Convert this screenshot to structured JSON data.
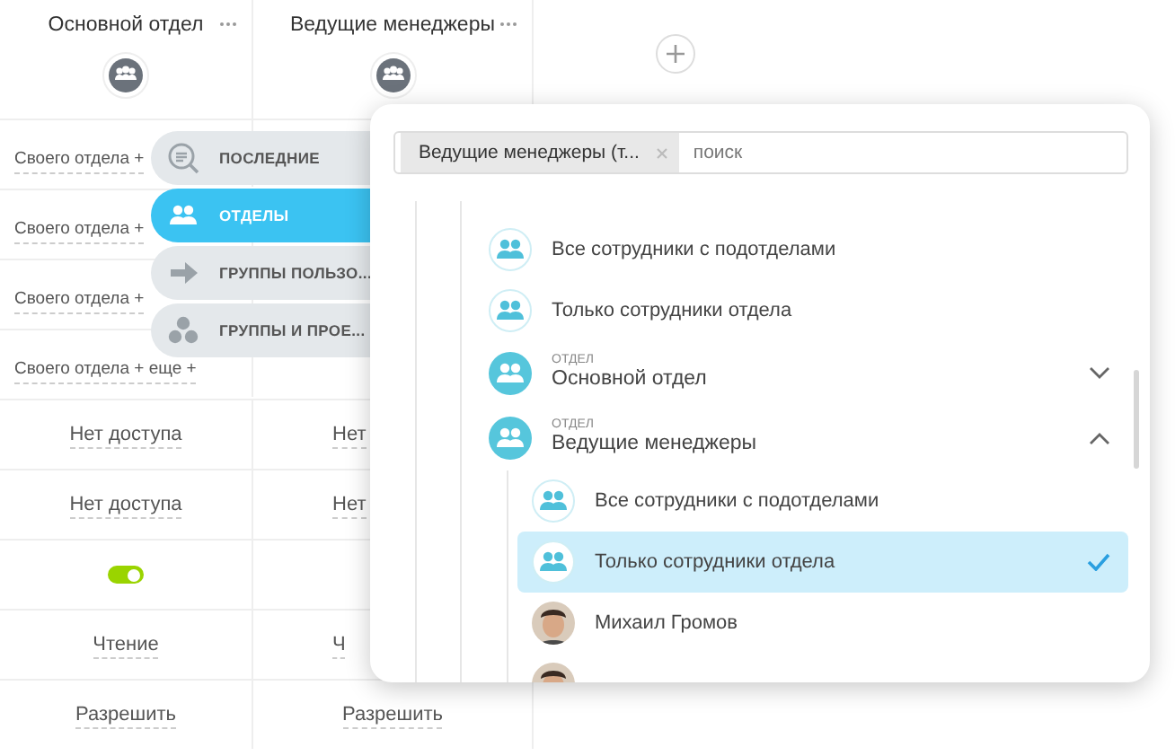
{
  "table": {
    "columns": [
      {
        "title": "Основной отдел"
      },
      {
        "title": "Ведущие менеджеры"
      }
    ],
    "rows": [
      {
        "cells": [
          {
            "kind": "link",
            "text": "Своего отдела +"
          }
        ]
      },
      {
        "cells": [
          {
            "kind": "link",
            "text": "Своего отдела +"
          }
        ]
      },
      {
        "cells": [
          {
            "kind": "link",
            "text": "Своего отдела +"
          }
        ]
      },
      {
        "cells": [
          {
            "kind": "link",
            "text": "Своего отдела + еще +"
          }
        ]
      },
      {
        "cells": [
          {
            "kind": "value",
            "text": "Нет доступа"
          },
          {
            "kind": "cut",
            "text": "Нет"
          }
        ]
      },
      {
        "cells": [
          {
            "kind": "value",
            "text": "Нет доступа"
          },
          {
            "kind": "cut",
            "text": "Нет"
          }
        ]
      },
      {
        "cells": [
          {
            "kind": "toggle",
            "on": true
          }
        ]
      },
      {
        "cells": [
          {
            "kind": "value",
            "text": "Чтение"
          },
          {
            "kind": "cut",
            "text": "Ч"
          }
        ]
      },
      {
        "cells": [
          {
            "kind": "value",
            "text": "Разрешить"
          },
          {
            "kind": "value",
            "text": "Разрешить"
          }
        ]
      }
    ]
  },
  "side_menu": [
    {
      "label": "ПОСЛЕДНИЕ",
      "selected": false
    },
    {
      "label": "ОТДЕЛЫ",
      "selected": true
    },
    {
      "label": "ГРУППЫ ПОЛЬЗО...",
      "selected": false
    },
    {
      "label": "ГРУППЫ И ПРОЕ...",
      "selected": false
    }
  ],
  "popup": {
    "search": {
      "chip": "Ведущие менеджеры (т...",
      "placeholder": "поиск"
    },
    "tree": [
      {
        "kind": "option",
        "label": "Все сотрудники с подотделами",
        "selected": false
      },
      {
        "kind": "option",
        "label": "Только сотрудники отдела",
        "selected": false
      },
      {
        "kind": "department",
        "caption": "ОТДЕЛ",
        "label": "Основной отдел",
        "expanded": false
      },
      {
        "kind": "department",
        "caption": "ОТДЕЛ",
        "label": "Ведущие менеджеры",
        "expanded": true,
        "children": [
          {
            "kind": "option",
            "label": "Все сотрудники с подотделами",
            "selected": false
          },
          {
            "kind": "option",
            "label": "Только сотрудники отдела",
            "selected": true
          },
          {
            "kind": "person",
            "label": "Михаил Громов"
          },
          {
            "kind": "person"
          }
        ]
      }
    ]
  }
}
